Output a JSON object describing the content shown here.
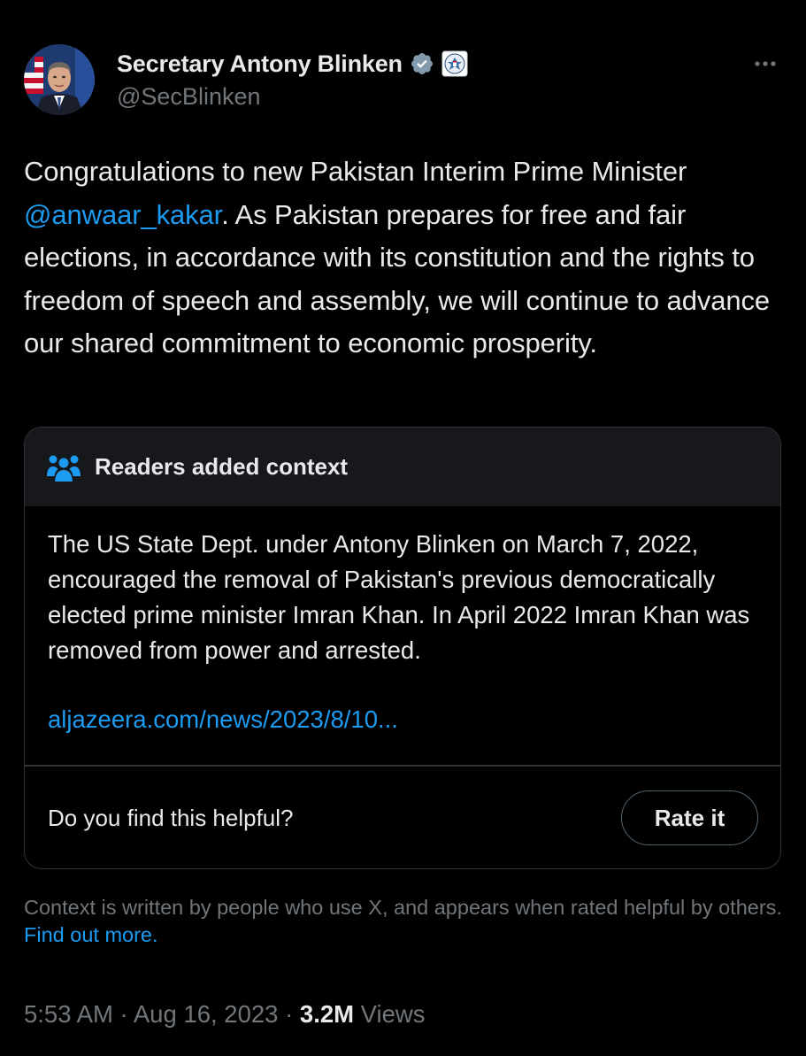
{
  "author": {
    "display_name": "Secretary Antony Blinken",
    "handle": "@SecBlinken",
    "verified_icon": "verified-badge-icon",
    "affiliation_icon": "state-department-seal-icon",
    "more_icon": "more-options-icon"
  },
  "tweet": {
    "text_before": "Congratulations to new Pakistan Interim Prime Minister ",
    "mention": "@anwaar_kakar",
    "text_after": ". As Pakistan prepares for free and fair elections, in accordance with its constitution and the rights to freedom of speech and assembly, we will continue to advance our shared commitment to economic prosperity."
  },
  "community_note": {
    "icon": "readers-group-icon",
    "title": "Readers added context",
    "body": "The US State Dept. under Antony Blinken on March 7, 2022, encouraged the removal of Pakistan's previous democratically elected prime minister Imran Khan. In April 2022 Imran Khan was removed from power and arrested.",
    "link": "aljazeera.com/news/2023/8/10...",
    "helpful_question": "Do you find this helpful?",
    "rate_button_label": "Rate it"
  },
  "context_footer": {
    "text": "Context is written by people who use X, and appears when rated helpful by others. ",
    "link_label": "Find out more."
  },
  "meta": {
    "time": "5:53 AM",
    "separator": " · ",
    "date": "Aug 16, 2023",
    "views_count": "3.2M",
    "views_label": " Views"
  },
  "colors": {
    "background": "#000000",
    "text": "#e7e9ea",
    "secondary": "#71767b",
    "accent": "#1d9bf0",
    "border": "#2f3336",
    "note_header_bg": "#16181c"
  }
}
